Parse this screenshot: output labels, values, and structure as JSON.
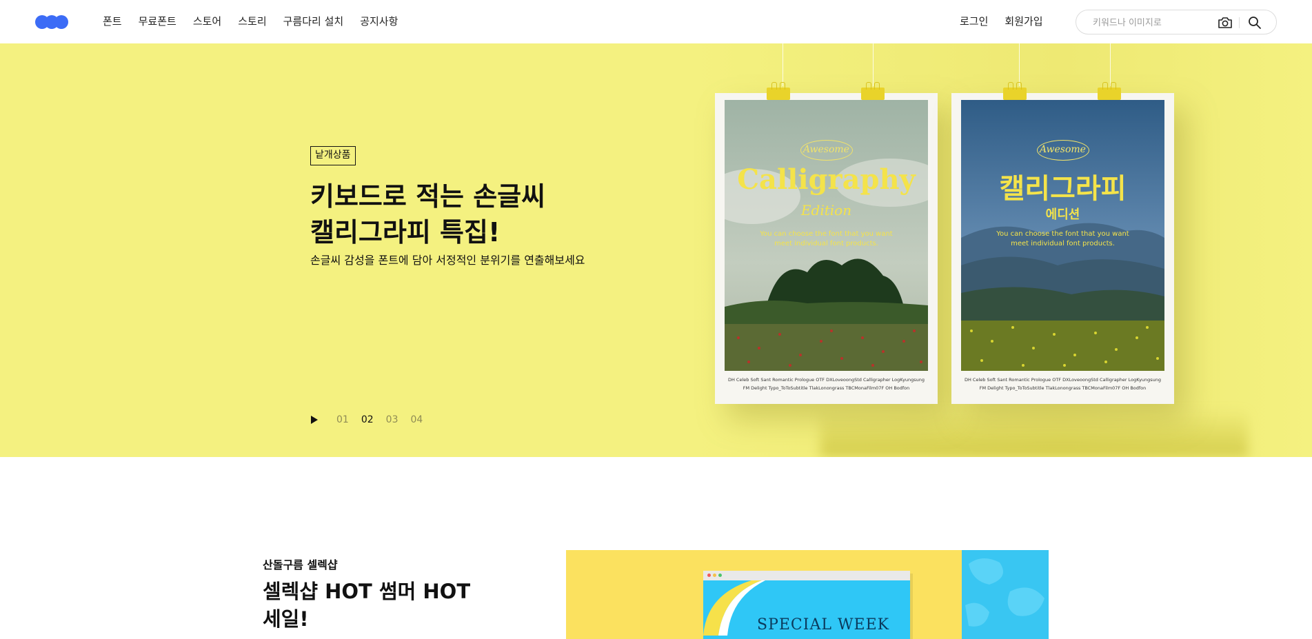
{
  "header": {
    "nav": [
      "폰트",
      "무료폰트",
      "스토어",
      "스토리",
      "구름다리 설치",
      "공지사항"
    ],
    "login": "로그인",
    "signup": "회원가입",
    "search_placeholder": "키워드나 이미지로"
  },
  "hero": {
    "badge": "낱개상품",
    "title": "키보드로 적는 손글씨\n캘리그라피 특집!",
    "subtitle": "손글씨 감성을 폰트에 담아 서정적인 분위기를 연출해보세요",
    "pages": [
      "01",
      "02",
      "03",
      "04"
    ],
    "active_page": "02",
    "poster_left": {
      "oval": "Awesome",
      "title": "Calligraphy",
      "edition": "Edition",
      "tagline": "You can choose the font that you want\nmeet individual font products.",
      "fonts_line1": "DH Celeb Soft   Sant Romantic Prologue OTF   DXLoveoongStd   Calligrapher   LogKyungsung",
      "fonts_line2": "FM Delight   Typo_ToToSubtitle   TlakLonongrass   TBCMonaFilm07F   OH Bodfon"
    },
    "poster_right": {
      "oval": "Awesome",
      "title": "캘리그라피",
      "edition": "에디션",
      "tagline": "You can choose the font that you want\nmeet individual font products.",
      "fonts_line1": "DH Celeb Soft   Sant Romantic Prologue OTF   DXLoveoongStd   Calligrapher   LogKyungsung",
      "fonts_line2": "FM Delight   Typo_ToToSubtitle   TlakLonongrass   TBCMonaFilm07F   OH Bodfon"
    }
  },
  "section2": {
    "label": "산돌구름 셀렉샵",
    "title": "셀렉샵 HOT 썸머 HOT\n세일!",
    "promo_text": "SPECIAL WEEK"
  },
  "colors": {
    "hero_bg": "#f4f180",
    "logo": "#3c6cf6",
    "poster_accent": "#f4e34a",
    "promo_bg": "#fbe15f",
    "pool": "#39c6f2"
  },
  "icons": [
    "logo",
    "camera-icon",
    "search-icon",
    "play-icon",
    "binder-clip-icon"
  ]
}
